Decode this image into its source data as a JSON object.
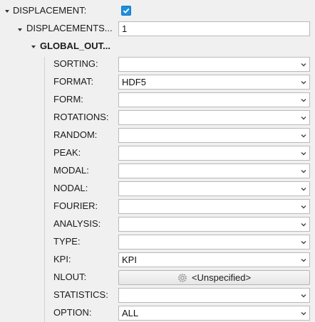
{
  "tree": {
    "displacement": {
      "label": "DISPLACEMENT:",
      "checked": true
    },
    "displacements": {
      "label": "DISPLACEMENTS...",
      "value": "1"
    },
    "global_out": {
      "label": "GLOBAL_OUT..."
    }
  },
  "rows": [
    {
      "label": "SORTING:",
      "value": ""
    },
    {
      "label": "FORMAT:",
      "value": "HDF5"
    },
    {
      "label": "FORM:",
      "value": ""
    },
    {
      "label": "ROTATIONS:",
      "value": ""
    },
    {
      "label": "RANDOM:",
      "value": ""
    },
    {
      "label": "PEAK:",
      "value": ""
    },
    {
      "label": "MODAL:",
      "value": ""
    },
    {
      "label": "NODAL:",
      "value": ""
    },
    {
      "label": "FOURIER:",
      "value": ""
    },
    {
      "label": "ANALYSIS:",
      "value": ""
    },
    {
      "label": "TYPE:",
      "value": ""
    },
    {
      "label": "KPI:",
      "value": "KPI"
    },
    {
      "label": "NLOUT:",
      "button": "<Unspecified>",
      "icon": "gear-icon"
    },
    {
      "label": "STATISTICS:",
      "value": ""
    },
    {
      "label": "OPTION:",
      "value": "ALL"
    }
  ],
  "colors": {
    "checkbox": "#1e8fdd",
    "background": "#f0f0f0",
    "field_border": "#b9b9b9"
  }
}
